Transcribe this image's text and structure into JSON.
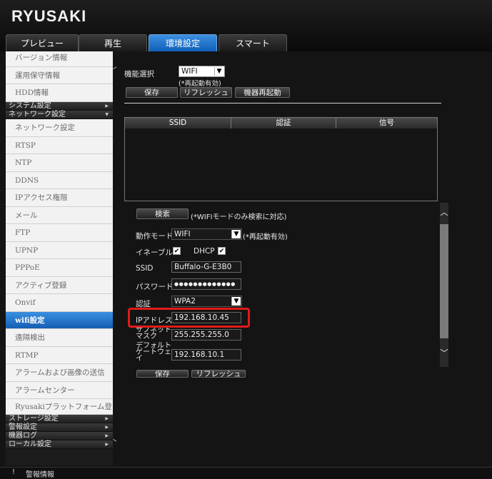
{
  "header": {
    "logo": "RYUSAKI",
    "tabs": [
      "プレビュー",
      "再生",
      "環境設定",
      "スマート"
    ]
  },
  "sidebar": {
    "items_top": [
      "バージョン情報",
      "運用保守情報",
      "HDD情報"
    ],
    "cat_system": "システム設定",
    "cat_network": "ネットワーク設定",
    "items_network": [
      "ネットワーク設定",
      "RTSP",
      "NTP",
      "DDNS",
      "IPアクセス権限",
      "メール",
      "FTP",
      "UPNP",
      "PPPoE",
      "アクティブ登録",
      "Onvif",
      "wifi設定",
      "遠隔検出",
      "RTMP",
      "アラームおよび画像の送信",
      "アラームセンター",
      "Ryusakiプラットフォーム登録"
    ],
    "cat_storage": "ストレージ設定",
    "cat_alarm": "警報設定",
    "cat_log": "機器ログ",
    "cat_local": "ローカル設定"
  },
  "main": {
    "func_select_label": "機能選択",
    "func_select_value": "WIFI",
    "func_note": "(*再起動有効)",
    "btn_save": "保存",
    "btn_refresh": "リフレッシュ",
    "btn_reboot": "機器再起動",
    "table_headers": [
      "SSID",
      "認証",
      "信号"
    ],
    "btn_search": "検索",
    "search_note": "(*WIFIモードのみ検索に対応)",
    "mode_label": "動作モード",
    "mode_value": "WIFI",
    "mode_note": "(*再起動有効)",
    "enable_label": "イネーブル",
    "dhcp_label": "DHCP",
    "ssid_label": "SSID",
    "ssid_value": "Buffalo-G-E3B0",
    "password_label": "パスワード",
    "password_value": "●●●●●●●●●●●●●",
    "auth_label": "認証",
    "auth_value": "WPA2",
    "ip_label": "IPアドレス",
    "ip_value": "192.168.10.45",
    "subnet_label_1": "サブネット",
    "subnet_label_2": "マスク",
    "subnet_value": "255.255.255.0",
    "gateway_label_1": "デフォルト",
    "gateway_label_2": "ゲートウェ",
    "gateway_label_3": "イ",
    "gateway_value": "192.168.10.1",
    "btn_save2": "保存",
    "btn_refresh2": "リフレッシュ"
  },
  "status": {
    "label": "警報情報"
  }
}
